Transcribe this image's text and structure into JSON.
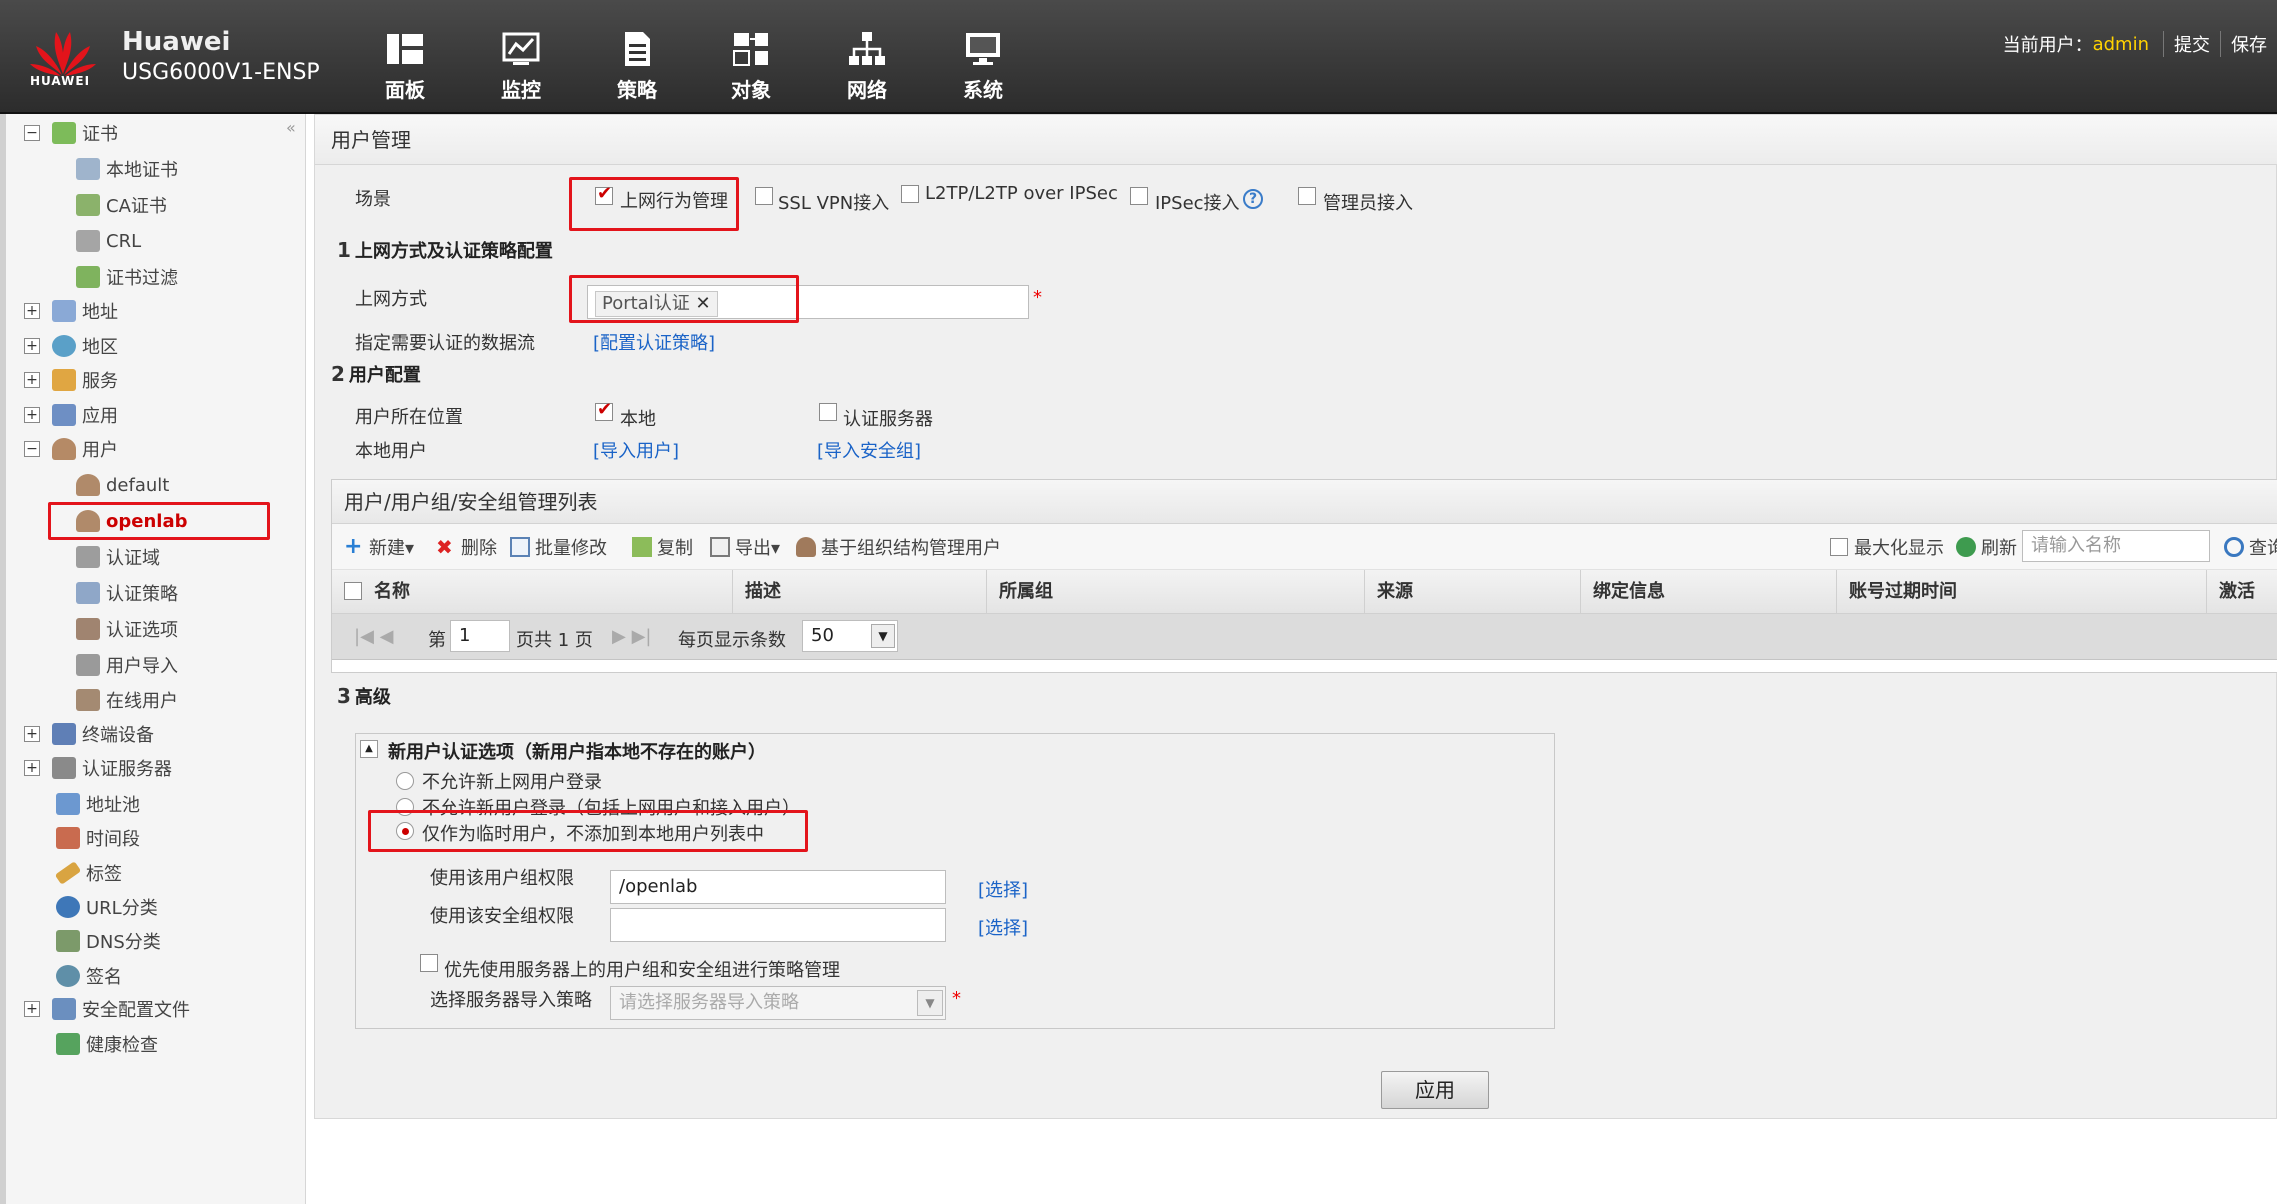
{
  "header": {
    "logo_text": "HUAWEI",
    "brand": "Huawei",
    "device": "USG6000V1-ENSP",
    "nav": [
      {
        "label": "面板",
        "icon": "dashboard-icon"
      },
      {
        "label": "监控",
        "icon": "monitor-icon"
      },
      {
        "label": "策略",
        "icon": "policy-icon"
      },
      {
        "label": "对象",
        "icon": "object-icon"
      },
      {
        "label": "网络",
        "icon": "network-icon"
      },
      {
        "label": "系统",
        "icon": "system-icon"
      }
    ],
    "current_user_label": "当前用户：",
    "current_user": "admin",
    "submit": "提交",
    "save": "保存"
  },
  "sidebar": {
    "collapse": "«",
    "items": [
      {
        "label": "证书",
        "toggle": "−",
        "icon": "certificate-icon"
      },
      {
        "label": "本地证书",
        "icon": "local-certificate-icon"
      },
      {
        "label": "CA证书",
        "icon": "ca-certificate-icon"
      },
      {
        "label": "CRL",
        "icon": "crl-icon"
      },
      {
        "label": "证书过滤",
        "icon": "certificate-filter-icon"
      },
      {
        "label": "地址",
        "toggle": "+",
        "icon": "address-icon"
      },
      {
        "label": "地区",
        "toggle": "+",
        "icon": "region-icon"
      },
      {
        "label": "服务",
        "toggle": "+",
        "icon": "service-icon"
      },
      {
        "label": "应用",
        "toggle": "+",
        "icon": "application-icon"
      },
      {
        "label": "用户",
        "toggle": "−",
        "icon": "user-icon"
      },
      {
        "label": "default",
        "icon": "user-group-icon"
      },
      {
        "label": "openlab",
        "icon": "user-group-icon"
      },
      {
        "label": "认证域",
        "icon": "auth-domain-icon"
      },
      {
        "label": "认证策略",
        "icon": "auth-policy-icon"
      },
      {
        "label": "认证选项",
        "icon": "auth-option-icon"
      },
      {
        "label": "用户导入",
        "icon": "user-import-icon"
      },
      {
        "label": "在线用户",
        "icon": "online-user-icon"
      },
      {
        "label": "终端设备",
        "toggle": "+",
        "icon": "terminal-device-icon"
      },
      {
        "label": "认证服务器",
        "toggle": "+",
        "icon": "auth-server-icon"
      },
      {
        "label": "地址池",
        "icon": "address-pool-icon"
      },
      {
        "label": "时间段",
        "icon": "time-range-icon"
      },
      {
        "label": "标签",
        "icon": "tag-icon"
      },
      {
        "label": "URL分类",
        "icon": "url-category-icon"
      },
      {
        "label": "DNS分类",
        "icon": "dns-category-icon"
      },
      {
        "label": "签名",
        "icon": "signature-icon"
      },
      {
        "label": "安全配置文件",
        "toggle": "+",
        "icon": "security-profile-icon"
      },
      {
        "label": "健康检查",
        "icon": "health-check-icon"
      }
    ]
  },
  "main": {
    "title": "用户管理",
    "scene_label": "场景",
    "scenes": [
      "上网行为管理",
      "SSL VPN接入",
      "L2TP/L2TP over IPSec",
      "IPSec接入",
      "管理员接入"
    ],
    "section1_num": "1",
    "section1": "上网方式及认证策略配置",
    "access_label": "上网方式",
    "access_tag": "Portal认证",
    "tag_close": "✕",
    "required_mark": "*",
    "flow_label": "指定需要认证的数据流",
    "flow_link": "[配置认证策略]",
    "section2_num": "2",
    "section2": "用户配置",
    "location_label": "用户所在位置",
    "location_local": "本地",
    "location_server": "认证服务器",
    "local_user_label": "本地用户",
    "import_user": "[导入用户]",
    "import_group": "[导入安全组]",
    "list": {
      "title": "用户/用户组/安全组管理列表",
      "toolbar": [
        "新建▾",
        "删除",
        "批量修改",
        "复制",
        "导出▾",
        "基于组织结构管理用户"
      ],
      "maximize": "最大化显示",
      "refresh": "刷新",
      "search_placeholder": "请输入名称",
      "query": "查询",
      "columns": [
        "名称",
        "描述",
        "所属组",
        "来源",
        "绑定信息",
        "账号过期时间",
        "激活"
      ],
      "pager_page_prefix": "第",
      "pager_page": "1",
      "pager_total": "页共 1 页",
      "pager_per_page": "每页显示条数",
      "pager_size": "50"
    },
    "section3_num": "3",
    "section3": "高级",
    "adv": {
      "collapse": "▲",
      "title": "新用户认证选项（新用户指本地不存在的账户）",
      "options": [
        "不允许新上网用户登录",
        "不允许新用户登录（包括上网用户和接入用户）",
        "仅作为临时用户，不添加到本地用户列表中"
      ],
      "group_perm_label": "使用该用户组权限",
      "group_perm_value": "/openlab",
      "group_select": "[选择]",
      "secgroup_perm_label": "使用该安全组权限",
      "secgroup_select": "[选择]",
      "prefer_server": "优先使用服务器上的用户组和安全组进行策略管理",
      "import_policy_label": "选择服务器导入策略",
      "import_policy_placeholder": "请选择服务器导入策略"
    },
    "apply": "应用"
  }
}
